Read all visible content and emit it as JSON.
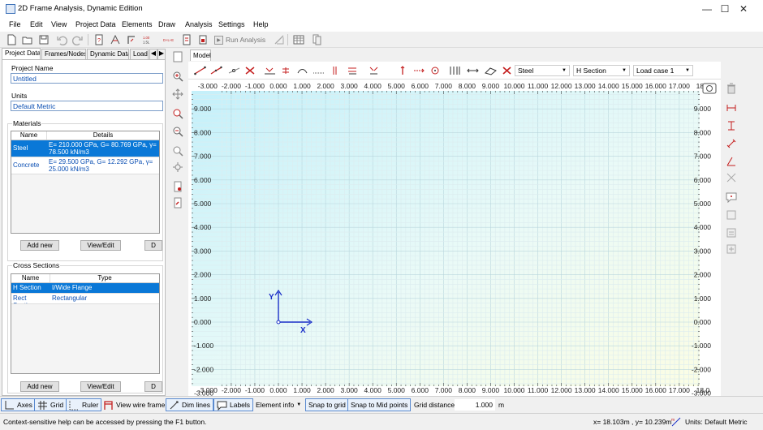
{
  "window": {
    "title": "2D Frame Analysis, Dynamic Edition"
  },
  "menu": [
    "File",
    "Edit",
    "View",
    "Project Data",
    "Elements",
    "Draw",
    "Analysis",
    "Settings",
    "Help"
  ],
  "toolbar": {
    "run_label": "Run Analysis"
  },
  "left_tabs": [
    "Project Data",
    "Frames/Nodes",
    "Dynamic Data",
    "Load"
  ],
  "project": {
    "name_label": "Project Name",
    "name_value": "Untitled",
    "units_label": "Units",
    "units_value": "Default Metric"
  },
  "materials": {
    "label": "Materials",
    "columns": [
      "Name",
      "Details"
    ],
    "rows": [
      {
        "name": "Steel",
        "details": "E= 210.000 GPa, G= 80.769 GPa, γ= 78.500 kN/m3"
      },
      {
        "name": "Concrete",
        "details": "E= 29.500 GPa, G= 12.292 GPa, γ= 25.000 kN/m3"
      }
    ],
    "add_label": "Add new",
    "view_label": "View/Edit",
    "del_label": "D"
  },
  "sections": {
    "label": "Cross Sections",
    "columns": [
      "Name",
      "Type"
    ],
    "rows": [
      {
        "name": "H Section",
        "type": "I/Wide Flange"
      },
      {
        "name": "Rect Section",
        "type": "Rectangular"
      }
    ],
    "add_label": "Add new",
    "view_label": "View/Edit",
    "del_label": "D"
  },
  "model": {
    "tab_label": "Model",
    "material_combo": "Steel",
    "section_combo": "H Section",
    "loadcase_combo": "Load case 1"
  },
  "canvas": {
    "x_ticks": [
      "-3.000",
      "-2.000",
      "-1.000",
      "0.000",
      "1.000",
      "2.000",
      "3.000",
      "4.000",
      "5.000",
      "6.000",
      "7.000",
      "8.000",
      "9.000",
      "10.000",
      "11.000",
      "12.000",
      "13.000",
      "14.000",
      "15.000",
      "16.000",
      "17.000",
      "18.0"
    ],
    "y_ticks": [
      "9.000",
      "8.000",
      "7.000",
      "6.000",
      "5.000",
      "4.000",
      "3.000",
      "2.000",
      "1.000",
      "0.000",
      "-1.000",
      "-2.000",
      "-3.000"
    ],
    "axis_x_label": "X",
    "axis_y_label": "Y"
  },
  "options": {
    "axes": "Axes",
    "grid": "Grid",
    "ruler": "Ruler",
    "wireframe": "View wire frame",
    "dimlines": "Dim lines",
    "labels": "Labels",
    "element_info": "Element info",
    "snap_grid": "Snap to grid",
    "snap_mid": "Snap to Mid points",
    "grid_distance_label": "Grid distance",
    "grid_distance_value": "1.000",
    "grid_distance_unit": "m"
  },
  "status": {
    "help": "Context-sensitive help can be accessed by pressing the F1 button.",
    "coords": "x= 18.103m , y= 10.239m",
    "units": "Units: Default Metric"
  },
  "colors": {
    "accent": "#0a78d7",
    "link": "#0b4fb3",
    "axes": "#1a2fc7",
    "tool_red": "#c41e1e"
  }
}
